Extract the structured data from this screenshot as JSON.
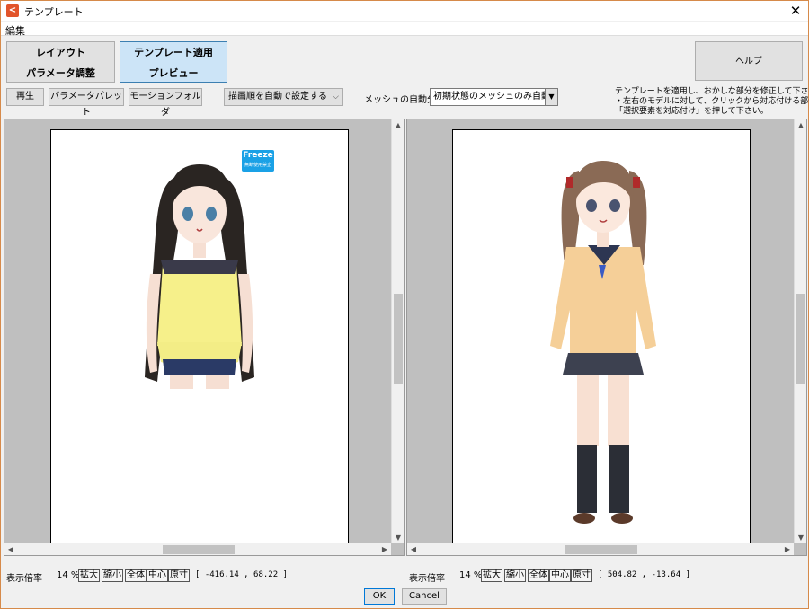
{
  "window": {
    "title": "テンプレート",
    "close": "✕",
    "icon": "app-logo-icon"
  },
  "menu": {
    "edit": "編集"
  },
  "tabs": {
    "layout_line1": "レイアウト",
    "layout_line2": "パラメータ調整",
    "template_line1": "テンプレート適用",
    "template_line2": "プレビュー"
  },
  "help": "ヘルプ",
  "toolbar": {
    "play": "再生",
    "param_palette": "パラメータパレット",
    "motion_folder": "モーションフォルダ",
    "draw_order": "描画順を自動で設定する",
    "mesh_label": "メッシュの自動分割",
    "mesh_value": "初期状態のメッシュのみ自動分割"
  },
  "instructions": {
    "line1": "テンプレートを適用し、おかしな部分を修正して下さい。",
    "line2": "・左右のモデルに対して、クリックから対応付ける部位を選び、",
    "line3": "「選択要素を対応付け」を押して下さい。"
  },
  "left_status": {
    "zoom_label": "表示倍率",
    "zoom_value": "14 %",
    "zoom_in": "拡大",
    "zoom_out": "縮小",
    "fit": "全体",
    "center": "中心",
    "actual": "原寸",
    "coords": "[ -416.14 ,   68.22 ]"
  },
  "right_status": {
    "zoom_label": "表示倍率",
    "zoom_value": "14 %",
    "zoom_in": "拡大",
    "zoom_out": "縮小",
    "fit": "全体",
    "center": "中心",
    "actual": "原寸",
    "coords": "[  504.82 ,  -13.64 ]"
  },
  "freeze_badge": {
    "title": "Freeze",
    "sub": "無断使用禁止"
  },
  "buttons": {
    "ok": "OK",
    "cancel": "Cancel"
  },
  "colors": {
    "active_tab": "#cce4f7",
    "accent": "#0078d7",
    "app_icon": "#e2542a",
    "freeze": "#1aa1e6"
  }
}
